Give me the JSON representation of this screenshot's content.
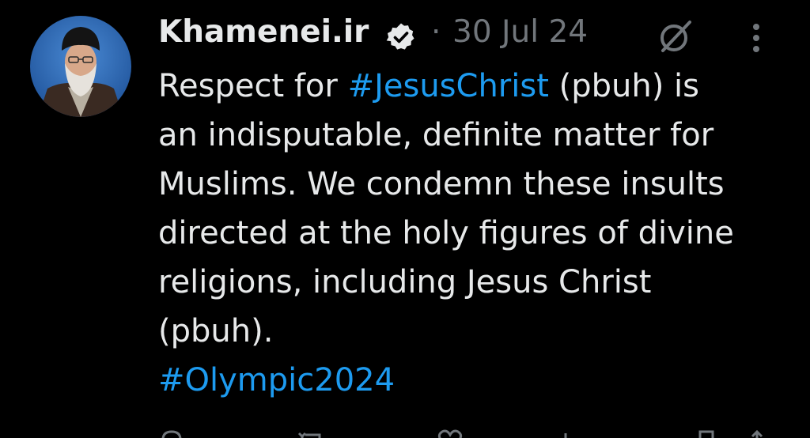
{
  "tweet": {
    "author_name": "Khamenei.ir",
    "separator": "·",
    "date": "30 Jul 24",
    "text": {
      "l1_pre": "Respect for ",
      "l1_tag": "#JesusChrist",
      "l1_post": " (pbuh) is",
      "l2": "an indisputable, definite matter for",
      "l3": "Muslims. We condemn these insults",
      "l4": "directed at the holy figures of divine",
      "l5": "religions, including Jesus Christ",
      "l6": "(pbuh).",
      "l7_tag": "#Olympic2024"
    }
  },
  "icons": {
    "verified": "verified-badge-icon",
    "grok": "grok-icon",
    "more": "more-vertical-icon",
    "reply": "reply-icon",
    "retweet": "retweet-icon",
    "like": "like-icon",
    "views": "views-icon",
    "bookmark": "bookmark-icon",
    "share": "share-icon"
  },
  "colors": {
    "background": "#000000",
    "text": "#e7e9ea",
    "muted": "#71767b",
    "link": "#1d9bf0"
  }
}
